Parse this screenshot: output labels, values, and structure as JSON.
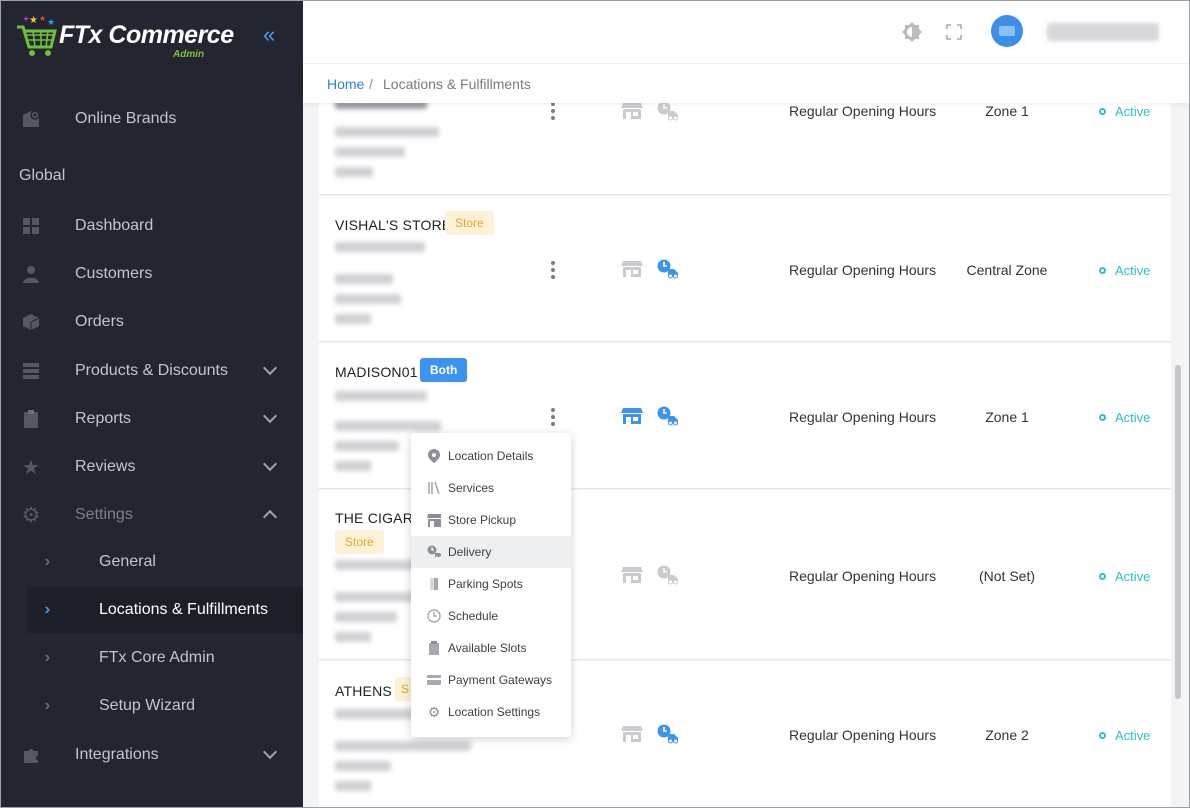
{
  "brand": {
    "name": "FTx Commerce",
    "subtitle": "Admin"
  },
  "sidebar": {
    "top_item": {
      "label": "Online Brands"
    },
    "section_label": "Global",
    "items": [
      {
        "label": "Dashboard"
      },
      {
        "label": "Customers"
      },
      {
        "label": "Orders"
      },
      {
        "label": "Products & Discounts"
      },
      {
        "label": "Reports"
      },
      {
        "label": "Reviews"
      },
      {
        "label": "Settings"
      },
      {
        "label": "Integrations"
      }
    ],
    "settings_sub": [
      {
        "label": "General"
      },
      {
        "label": "Locations & Fulfillments"
      },
      {
        "label": "FTx Core Admin"
      },
      {
        "label": "Setup Wizard"
      }
    ]
  },
  "breadcrumb": {
    "home": "Home",
    "separator": "/",
    "current": "Locations & Fulfillments"
  },
  "locations": [
    {
      "name": "",
      "badge": "",
      "hours": "Regular Opening Hours",
      "zone": "Zone 1",
      "status": "Active"
    },
    {
      "name": "VISHAL'S STORE",
      "badge": "Store",
      "hours": "Regular Opening Hours",
      "zone": "Central Zone",
      "status": "Active"
    },
    {
      "name": "MADISON01",
      "badge": "Both",
      "hours": "Regular Opening Hours",
      "zone": "Zone 1",
      "status": "Active"
    },
    {
      "name": "THE CIGARE",
      "badge": "Store",
      "hours": "Regular Opening Hours",
      "zone": "(Not Set)",
      "status": "Active"
    },
    {
      "name": "ATHENS",
      "badge": "S",
      "hours": "Regular Opening Hours",
      "zone": "Zone 2",
      "status": "Active"
    }
  ],
  "context_menu": [
    {
      "label": "Location Details",
      "icon": "map-pin-icon"
    },
    {
      "label": "Services",
      "icon": "services-icon"
    },
    {
      "label": "Store Pickup",
      "icon": "store-icon"
    },
    {
      "label": "Delivery",
      "icon": "delivery-icon"
    },
    {
      "label": "Parking Spots",
      "icon": "parking-icon"
    },
    {
      "label": "Schedule",
      "icon": "clock-icon"
    },
    {
      "label": "Available Slots",
      "icon": "clipboard-icon"
    },
    {
      "label": "Payment Gateways",
      "icon": "credit-card-icon"
    },
    {
      "label": "Location Settings",
      "icon": "gear-icon"
    }
  ],
  "colors": {
    "sidebar_bg": "#232530",
    "accent": "#2f7ed8",
    "active_status": "#2bbfc9",
    "store_badge_bg": "#fdf2d8",
    "both_badge_bg": "#3d94f0"
  }
}
